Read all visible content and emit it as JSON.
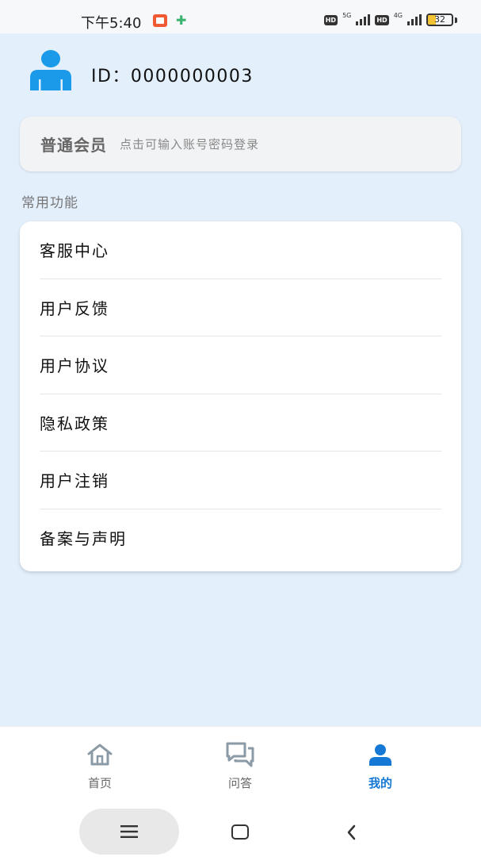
{
  "status_bar": {
    "time": "下午5:40",
    "net1": "5G",
    "net2": "4G",
    "hd1": "HD",
    "hd2": "HD",
    "battery": "32",
    "battery_level": 0.32,
    "battery_color": "#f2c335"
  },
  "profile": {
    "avatar_icon": "user-avatar-icon",
    "id_text": "ID：0000000003",
    "avatar_color": "#1a9ae8"
  },
  "member": {
    "level": "普通会员",
    "hint": "点击可输入账号密码登录"
  },
  "section": {
    "title": "常用功能"
  },
  "menu": {
    "items": [
      {
        "label": "客服中心"
      },
      {
        "label": "用户反馈"
      },
      {
        "label": "用户协议"
      },
      {
        "label": "隐私政策"
      },
      {
        "label": "用户注销"
      },
      {
        "label": "备案与声明"
      }
    ]
  },
  "bottom_nav": {
    "tabs": [
      {
        "label": "首页",
        "icon": "home-icon",
        "active": false
      },
      {
        "label": "问答",
        "icon": "chat-icon",
        "active": false
      },
      {
        "label": "我的",
        "icon": "person-icon",
        "active": true
      }
    ],
    "active_color": "#1478d4",
    "inactive_color": "#666666"
  },
  "system_nav": {
    "menu_icon": "hamburger-icon",
    "home_icon": "square-home-icon",
    "back_icon": "back-chevron-icon"
  }
}
